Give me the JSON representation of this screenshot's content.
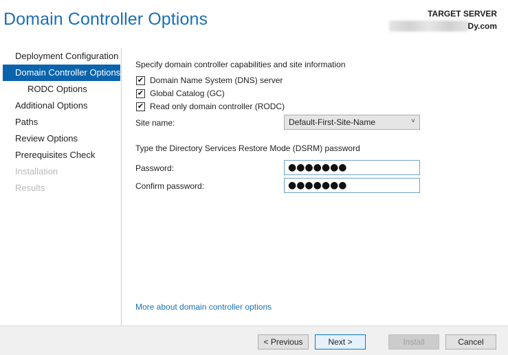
{
  "header": {
    "title": "Domain Controller Options",
    "target_label": "TARGET SERVER",
    "target_value": "Dy.com"
  },
  "nav": {
    "items": [
      {
        "label": "Deployment Configuration",
        "state": "normal"
      },
      {
        "label": "Domain Controller Options",
        "state": "active"
      },
      {
        "label": "RODC Options",
        "state": "indent"
      },
      {
        "label": "Additional Options",
        "state": "normal"
      },
      {
        "label": "Paths",
        "state": "normal"
      },
      {
        "label": "Review Options",
        "state": "normal"
      },
      {
        "label": "Prerequisites Check",
        "state": "normal"
      },
      {
        "label": "Installation",
        "state": "disabled"
      },
      {
        "label": "Results",
        "state": "disabled"
      }
    ]
  },
  "main": {
    "capabilities_heading": "Specify domain controller capabilities and site information",
    "checkboxes": [
      {
        "label": "Domain Name System (DNS) server",
        "checked": true
      },
      {
        "label": "Global Catalog (GC)",
        "checked": true
      },
      {
        "label": "Read only domain controller (RODC)",
        "checked": true
      }
    ],
    "site_name_label": "Site name:",
    "site_name_value": "Default-First-Site-Name",
    "dsrm_heading": "Type the Directory Services Restore Mode (DSRM) password",
    "password_label": "Password:",
    "password_value": "●●●●●●●",
    "confirm_label": "Confirm password:",
    "confirm_value": "●●●●●●●",
    "more_link": "More about domain controller options"
  },
  "footer": {
    "previous": "< Previous",
    "next": "Next >",
    "install": "Install",
    "cancel": "Cancel"
  },
  "icons": {
    "check": "checkmark-icon",
    "dropdown": "chevron-down-icon"
  },
  "colors": {
    "accent": "#1a6fb5",
    "nav_active": "#0a64ad"
  }
}
